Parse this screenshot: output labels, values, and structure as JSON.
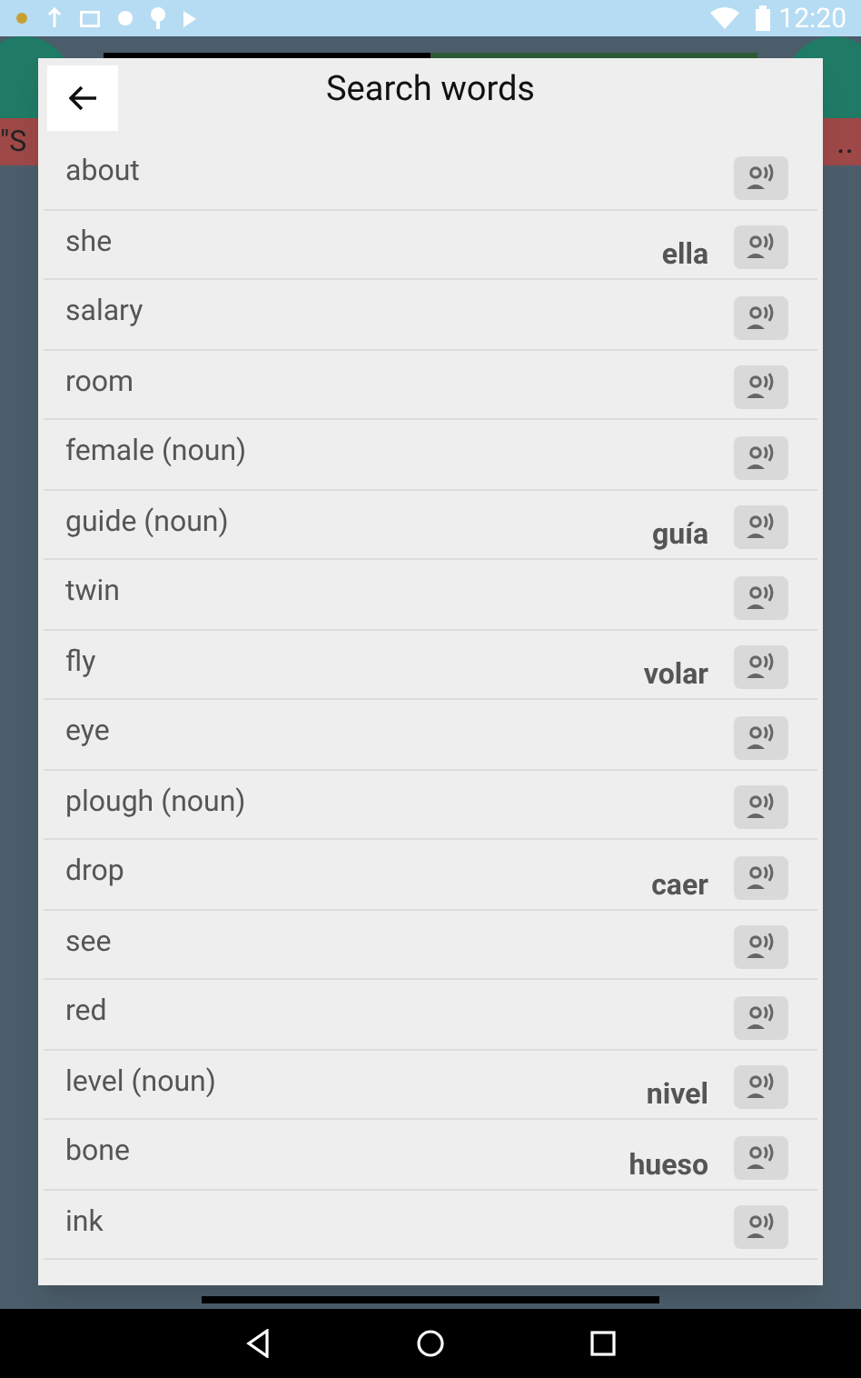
{
  "status_bar": {
    "time": "12:20"
  },
  "background": {
    "left_text": "\"S",
    "right_text": "..",
    "progress": {
      "level": 0.5
    }
  },
  "dialog": {
    "title": "Search words"
  },
  "words": [
    {
      "word": "about"
    },
    {
      "word": "she",
      "translation": "ella"
    },
    {
      "word": "salary"
    },
    {
      "word": "room"
    },
    {
      "word": "female (noun)"
    },
    {
      "word": "guide (noun)",
      "translation": "guía"
    },
    {
      "word": "twin"
    },
    {
      "word": "fly",
      "translation": "volar"
    },
    {
      "word": "eye"
    },
    {
      "word": "plough (noun)"
    },
    {
      "word": "drop",
      "translation": "caer"
    },
    {
      "word": "see"
    },
    {
      "word": "red"
    },
    {
      "word": "level (noun)",
      "translation": "nivel"
    },
    {
      "word": "bone",
      "translation": "hueso"
    },
    {
      "word": "ink"
    }
  ]
}
